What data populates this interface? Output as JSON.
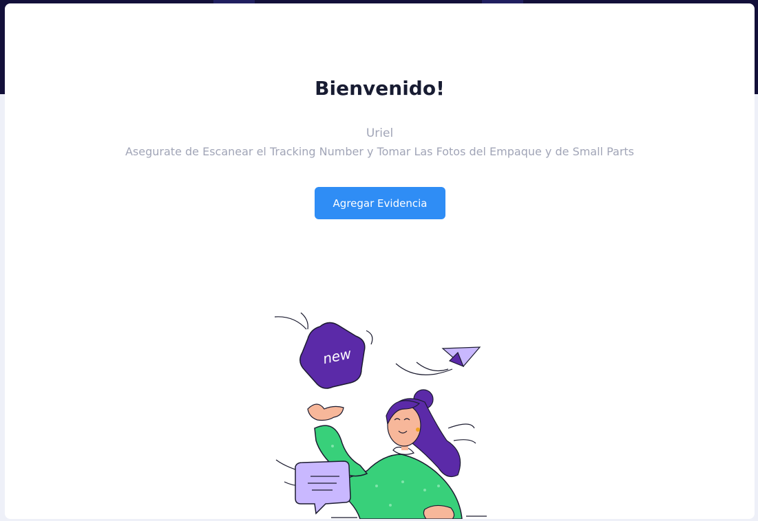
{
  "welcome": {
    "title": "Bienvenido!",
    "user_name": "Uriel",
    "instructions": "Asegurate de Escanear el Tracking Number y Tomar Las Fotos del Empaque y de Small Parts",
    "action_label": "Agregar Evidencia"
  },
  "illustration": {
    "badge_text": "new",
    "badge_icon": "star-badge-icon",
    "plane_icon": "paper-plane-icon",
    "chat_icon": "chat-bubble-icon"
  },
  "colors": {
    "banner": "#13103a",
    "primary": "#2f8df5",
    "title": "#181c32",
    "muted": "#a1a5b7",
    "purple": "#5b2aa8",
    "green": "#38d07a"
  }
}
